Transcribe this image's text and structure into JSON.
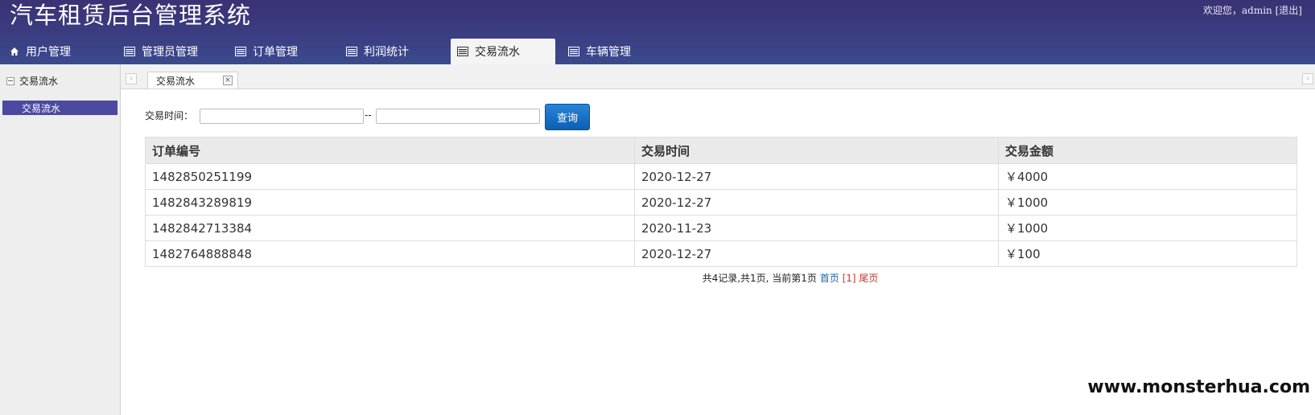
{
  "app": {
    "title": "汽车租赁后台管理系统",
    "welcome": "欢迎您，admin",
    "logout": "[退出]"
  },
  "nav": {
    "tabs": [
      {
        "label": "用户管理",
        "icon": "home-icon"
      },
      {
        "label": "管理员管理",
        "icon": "list-icon"
      },
      {
        "label": "订单管理",
        "icon": "list-icon"
      },
      {
        "label": "利润统计",
        "icon": "list-icon"
      },
      {
        "label": "交易流水",
        "icon": "list-icon",
        "active": true
      },
      {
        "label": "车辆管理",
        "icon": "list-icon"
      }
    ]
  },
  "sidebar": {
    "group_title": "交易流水",
    "items": [
      {
        "label": "交易流水",
        "selected": true
      }
    ]
  },
  "content_tabs": [
    {
      "label": "交易流水"
    }
  ],
  "search": {
    "label": "交易时间：",
    "separator": "--",
    "start_value": "",
    "end_value": "",
    "button_label": "查询"
  },
  "table": {
    "headers": [
      "订单编号",
      "交易时间",
      "交易金额"
    ],
    "rows": [
      [
        "1482850251199",
        "2020-12-27",
        "￥4000"
      ],
      [
        "1482843289819",
        "2020-12-27",
        "￥1000"
      ],
      [
        "1482842713384",
        "2020-11-23",
        "￥1000"
      ],
      [
        "1482764888848",
        "2020-12-27",
        "￥100"
      ]
    ]
  },
  "pagination": {
    "summary": "共4记录,共1页, 当前第1页",
    "first": "首页",
    "current": "[1]",
    "last": "尾页"
  },
  "watermark": "www.monsterhua.com",
  "colors": {
    "header": "#3b3a7e",
    "sidebar_selected": "#4b49a0",
    "query_button": "#0b5fb4"
  }
}
